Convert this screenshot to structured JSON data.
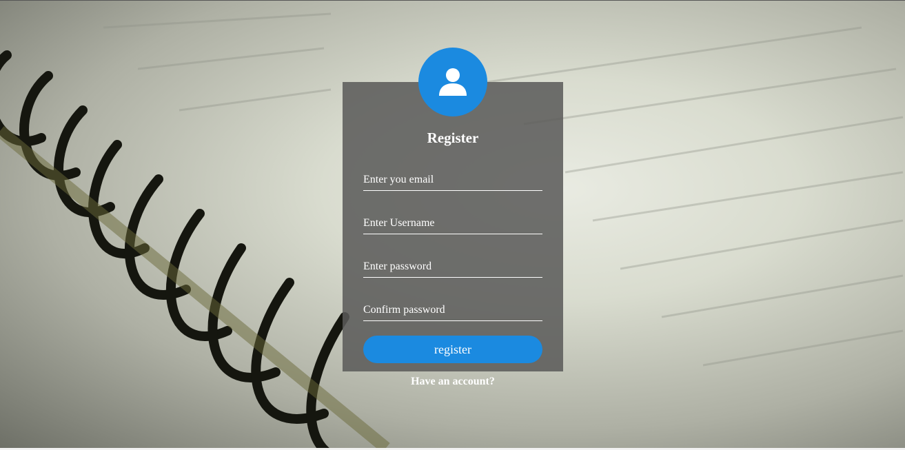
{
  "form": {
    "title": "Register",
    "email_placeholder": "Enter you email",
    "username_placeholder": "Enter Username",
    "password_placeholder": "Enter password",
    "confirm_placeholder": "Confirm password",
    "submit_label": "register",
    "account_link": "Have an account?"
  },
  "icons": {
    "avatar": "user-icon"
  },
  "colors": {
    "accent": "#1b8ae0",
    "card": "#5a5a58",
    "text": "#ffffff"
  }
}
